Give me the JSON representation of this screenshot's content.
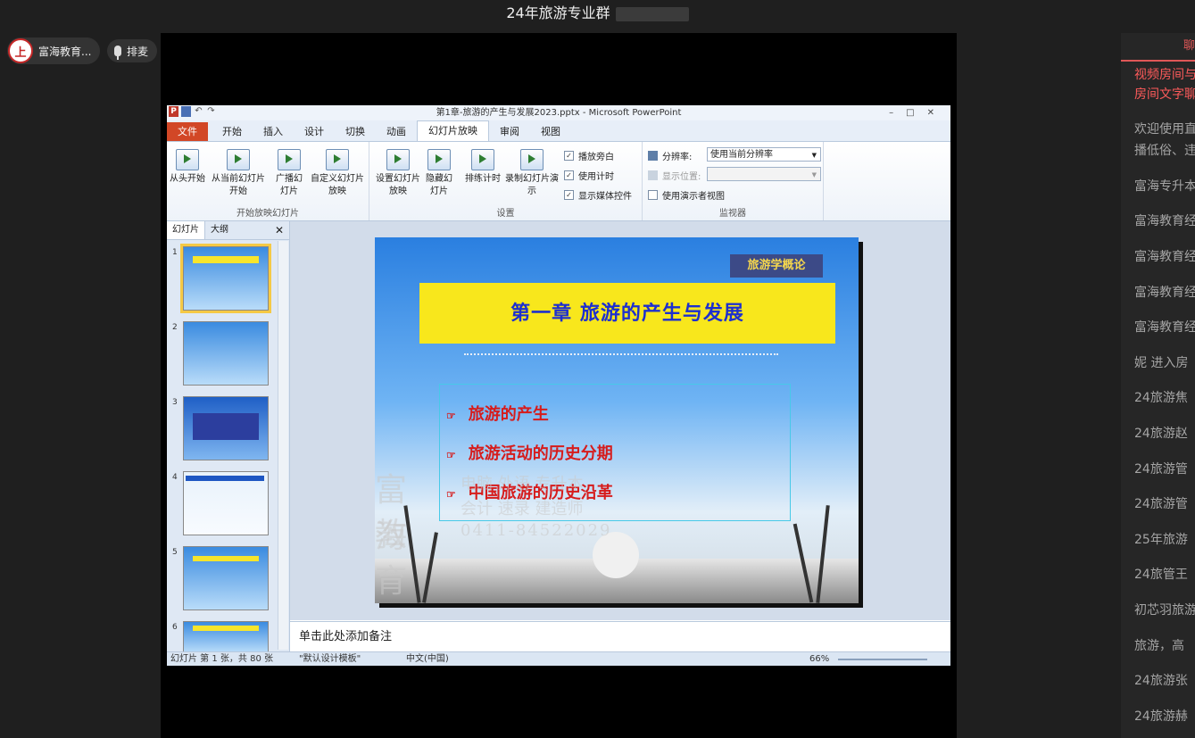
{
  "room": {
    "title": "24年旅游专业群"
  },
  "host": {
    "logo_char": "上",
    "name": "富海教育..."
  },
  "queue_button": {
    "label": "排麦"
  },
  "ppt": {
    "window_title": "第1章-旅游的产生与发展2023.pptx - Microsoft PowerPoint",
    "tabs": [
      "文件",
      "开始",
      "插入",
      "设计",
      "切换",
      "动画",
      "幻灯片放映",
      "审阅",
      "视图"
    ],
    "active_tab": "幻灯片放映",
    "groups": {
      "start": {
        "label": "开始放映幻灯片",
        "from_start": "从头开始",
        "from_current": "从当前幻灯片开始",
        "broadcast": "广播幻灯片",
        "custom": "自定义幻灯片放映"
      },
      "setup": {
        "label": "设置",
        "setup_show": "设置幻灯片放映",
        "hide_slide": "隐藏幻灯片",
        "rehearse": "排练计时",
        "record": "录制幻灯片演示",
        "play_narration": "播放旁白",
        "use_timings": "使用计时",
        "show_media": "显示媒体控件"
      },
      "monitor": {
        "label": "监视器",
        "resolution_label": "分辨率:",
        "resolution_value": "使用当前分辨率",
        "display_label": "显示位置:",
        "presenter_view": "使用演示者视图"
      }
    },
    "pane": {
      "tab_slides": "幻灯片",
      "tab_outline": "大纲",
      "close": "✕",
      "thumb_numbers": [
        "1",
        "2",
        "3",
        "4",
        "5",
        "6"
      ]
    },
    "slide": {
      "badge": "旅游学概论",
      "title": "第一章  旅游的产生与发展",
      "bullets": [
        "旅游的产生",
        "旅游活动的历史分期",
        "中国旅游的历史沿革"
      ],
      "bullet_icon": "☞"
    },
    "watermark": {
      "big1": "富海",
      "big2": "教育",
      "line1": "电脑  外语  专升本",
      "line2": "会计  速录  建造师",
      "phone": "0411-84522029"
    },
    "notes_placeholder": "单击此处添加备注",
    "status": {
      "slide_info": "幻灯片 第 1 张，共 80 张",
      "theme": "\"默认设计模板\"",
      "language": "中文(中国)",
      "zoom": "66%"
    }
  },
  "chat": {
    "tab_label": "聊",
    "notice_lines": [
      "视频房间与",
      "房间文字聊"
    ],
    "messages": [
      "欢迎使用直",
      "播低俗、违",
      "富海专升本",
      "富海教育经",
      "富海教育经",
      "富海教育经",
      "富海教育经",
      "妮 进入房",
      "24旅游焦",
      "24旅游赵",
      "24旅游管",
      "24旅游管",
      "25年旅游",
      "24旅管王",
      "初芯羽旅游",
      "旅游，高",
      "24旅游张",
      "24旅游赫"
    ]
  }
}
